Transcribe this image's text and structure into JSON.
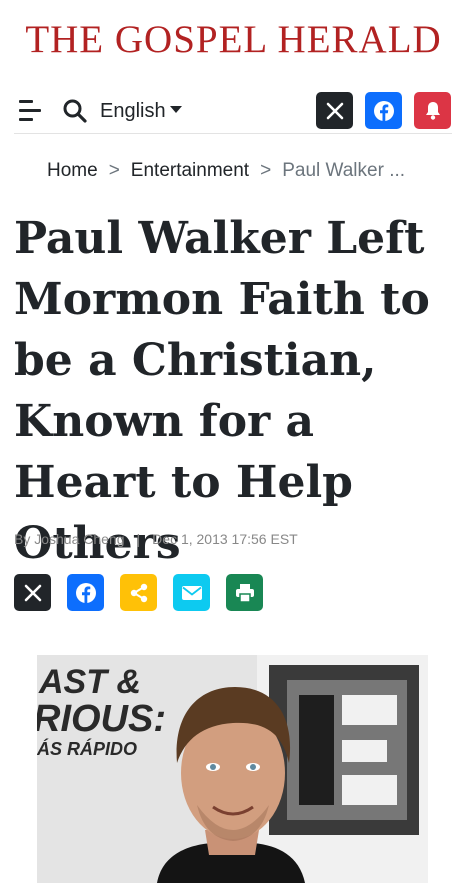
{
  "site": {
    "title": "THE GOSPEL HERALD"
  },
  "header": {
    "language": "English",
    "icons": {
      "menu": "menu-icon",
      "search": "search-icon",
      "x": "x-logo-icon",
      "facebook": "facebook-icon",
      "notification": "bell-icon"
    }
  },
  "breadcrumb": {
    "home": "Home",
    "separator": ">",
    "section": "Entertainment",
    "current": "Paul Walker ..."
  },
  "article": {
    "headline": "Paul Walker Left Mormon Faith to be a Christian, Known for a Heart to Help Others",
    "author": "By Joshua Cheng",
    "divider": "|",
    "date": "Dec 1, 2013 17:56 EST"
  },
  "share": {
    "icons": [
      "x-logo-icon",
      "facebook-icon",
      "share-icon",
      "email-icon",
      "print-icon"
    ]
  },
  "photo": {
    "backdrop_text_1": "AST &",
    "backdrop_text_2": "RIOUS:",
    "backdrop_text_3": "ÁS RÁPIDO"
  },
  "colors": {
    "brand_red": "#b22222",
    "x_black": "#212529",
    "facebook_blue": "#0d6efd",
    "bell_red": "#dc3545",
    "share_yellow": "#ffc107",
    "email_cyan": "#0dcaf0",
    "print_green": "#198754"
  }
}
